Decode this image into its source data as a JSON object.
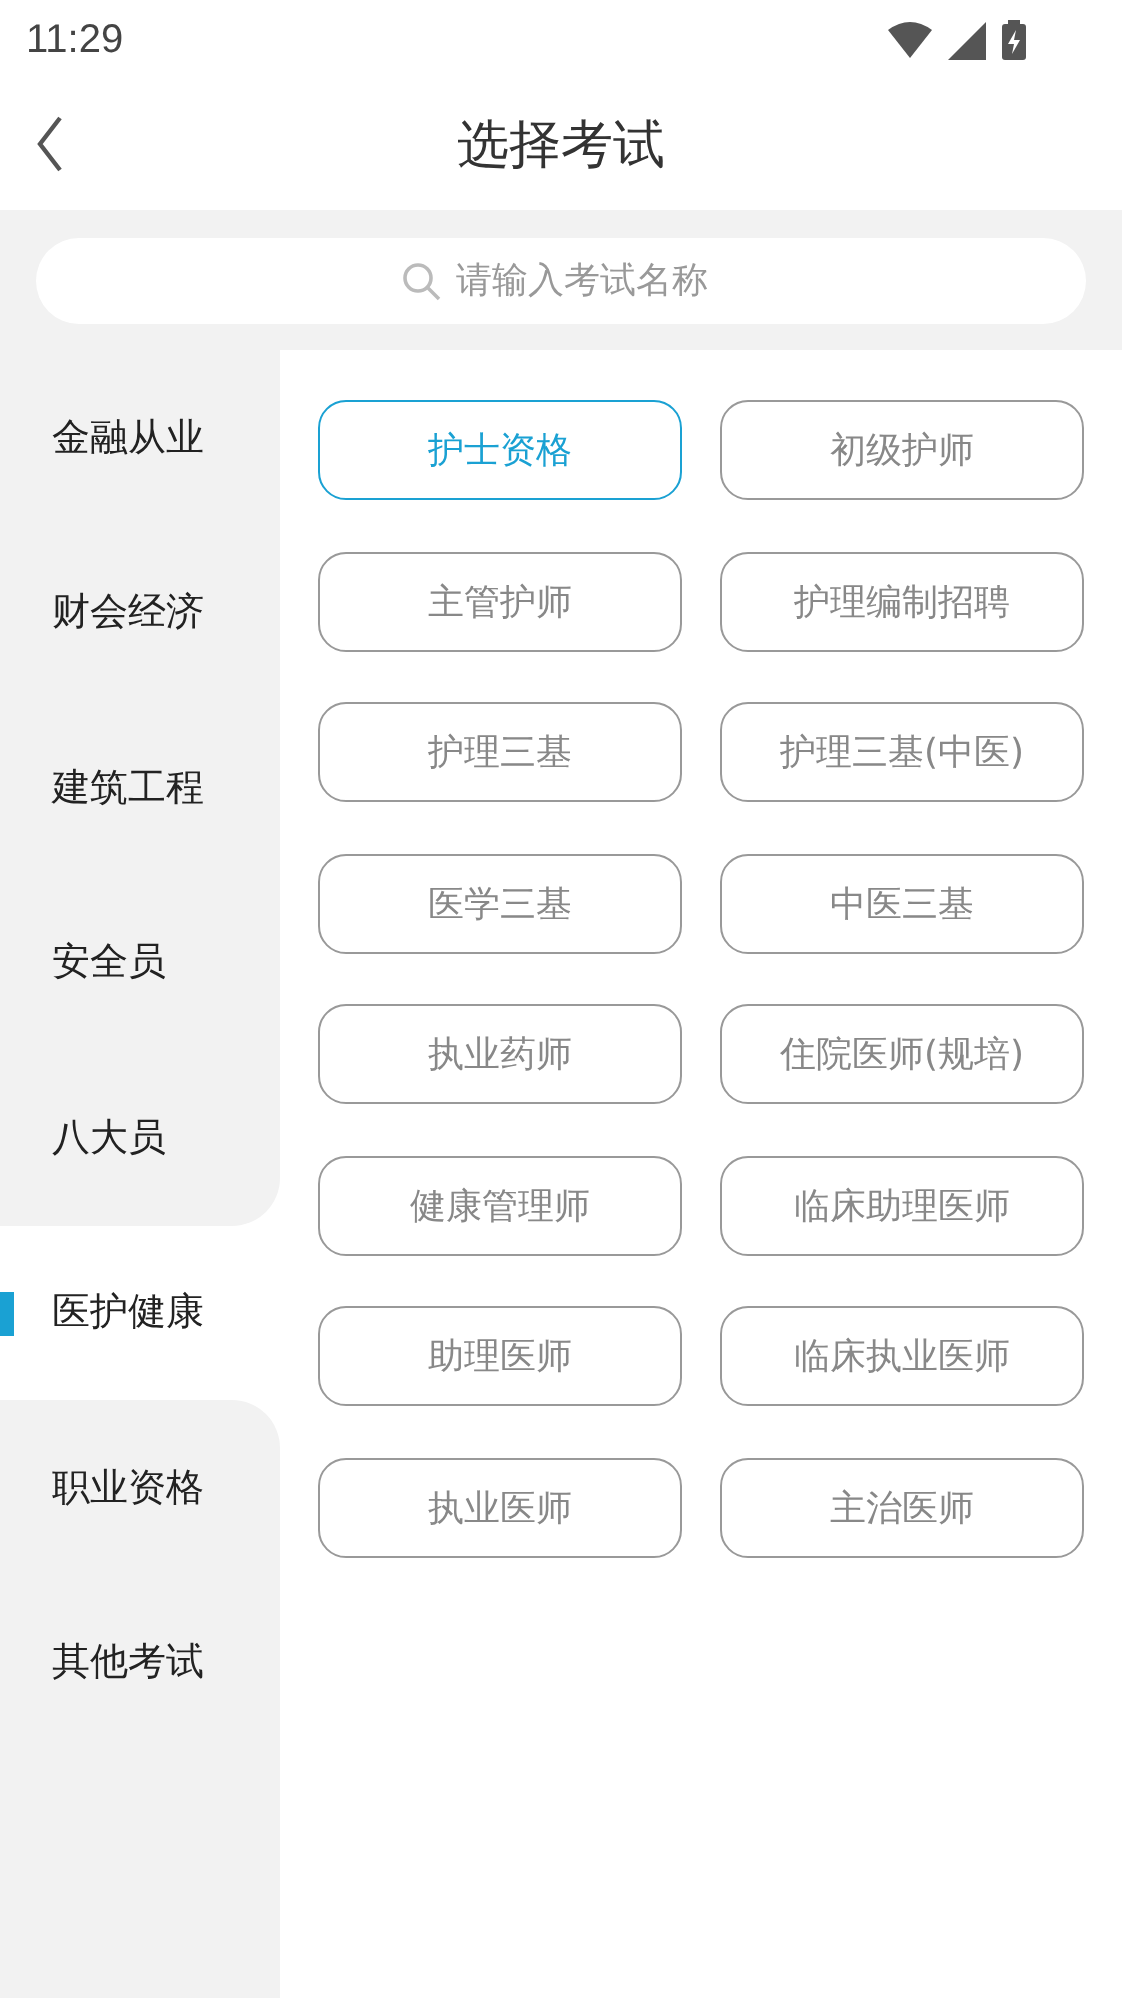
{
  "status_bar": {
    "time": "11:29"
  },
  "header": {
    "title": "选择考试"
  },
  "search": {
    "placeholder": "请输入考试名称"
  },
  "sidebar": {
    "items": [
      {
        "label": "金融从业",
        "selected": false
      },
      {
        "label": "财会经济",
        "selected": false
      },
      {
        "label": "建筑工程",
        "selected": false
      },
      {
        "label": "安全员",
        "selected": false
      },
      {
        "label": "八大员",
        "selected": false
      },
      {
        "label": "医护健康",
        "selected": true
      },
      {
        "label": "职业资格",
        "selected": false
      },
      {
        "label": "其他考试",
        "selected": false
      }
    ]
  },
  "exams": [
    {
      "label": "护士资格",
      "selected": true
    },
    {
      "label": "初级护师",
      "selected": false
    },
    {
      "label": "主管护师",
      "selected": false
    },
    {
      "label": "护理编制招聘",
      "selected": false
    },
    {
      "label": "护理三基",
      "selected": false
    },
    {
      "label": "护理三基(中医)",
      "selected": false
    },
    {
      "label": "医学三基",
      "selected": false
    },
    {
      "label": "中医三基",
      "selected": false
    },
    {
      "label": "执业药师",
      "selected": false
    },
    {
      "label": "住院医师(规培)",
      "selected": false
    },
    {
      "label": "健康管理师",
      "selected": false
    },
    {
      "label": "临床助理医师",
      "selected": false
    },
    {
      "label": "助理医师",
      "selected": false
    },
    {
      "label": "临床执业医师",
      "selected": false
    },
    {
      "label": "执业医师",
      "selected": false
    },
    {
      "label": "主治医师",
      "selected": false
    }
  ]
}
